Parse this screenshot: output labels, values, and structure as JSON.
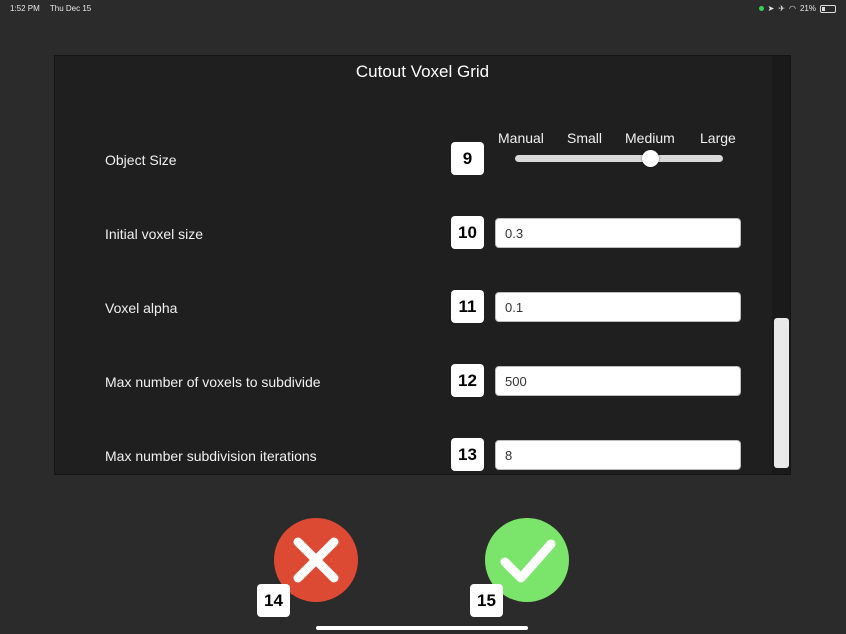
{
  "status_bar": {
    "time": "1:52 PM",
    "date": "Thu Dec 15",
    "battery": "21%",
    "icons": [
      "location-icon",
      "airplane-icon",
      "wifi-icon",
      "battery-icon"
    ]
  },
  "dialog": {
    "title": "Cutout Voxel Grid",
    "object_size": {
      "label": "Object Size",
      "badge": "9",
      "options": [
        "Manual",
        "Small",
        "Medium",
        "Large"
      ],
      "selected": "Medium",
      "level_fraction": 0.65
    },
    "fields": [
      {
        "label": "Initial voxel size",
        "badge": "10",
        "value": "0.3"
      },
      {
        "label": "Voxel alpha",
        "badge": "11",
        "value": "0.1"
      },
      {
        "label": "Max number of voxels to subdivide",
        "badge": "12",
        "value": "500"
      },
      {
        "label": "Max number subdivision iterations",
        "badge": "13",
        "value": "8"
      }
    ]
  },
  "actions": {
    "cancel": {
      "badge": "14",
      "icon": "close-icon",
      "color": "#dc4a33"
    },
    "confirm": {
      "badge": "15",
      "icon": "checkmark-icon",
      "color": "#7be46a"
    }
  }
}
